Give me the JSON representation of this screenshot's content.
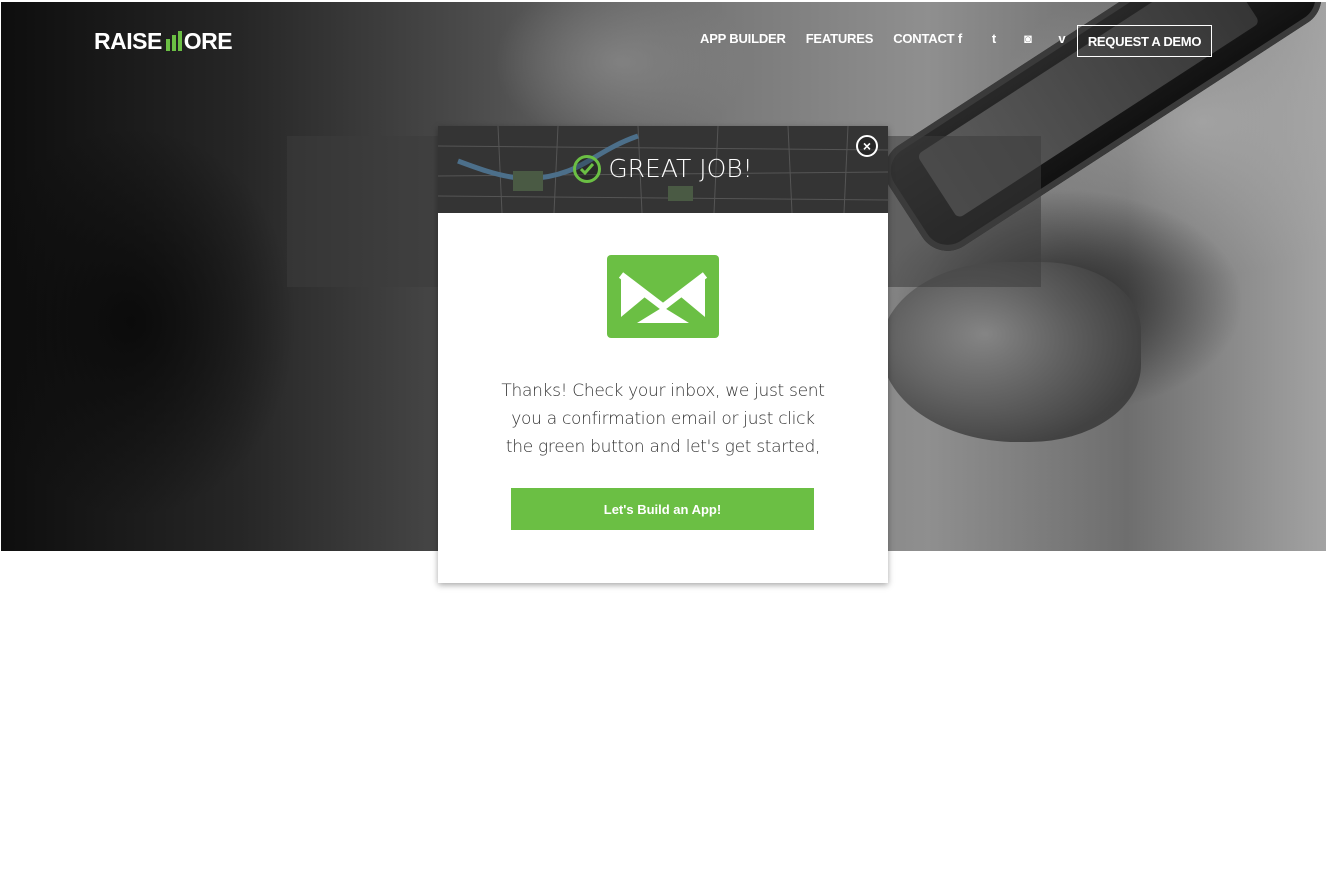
{
  "header": {
    "logo_text_left": "RAISE",
    "logo_text_right": "ORE",
    "nav": [
      "APP BUILDER",
      "FEATURES",
      "CONTACT"
    ],
    "social_icons": [
      "facebook-icon",
      "twitter-icon",
      "instagram-icon",
      "vimeo-icon"
    ],
    "social_glyphs": [
      "f",
      "t",
      "◙",
      "v"
    ],
    "demo_button": "REQUEST A DEMO"
  },
  "modal": {
    "title": "GREAT JOB!",
    "close_glyph": "×",
    "message": "Thanks! Check your inbox, we just sent you a confirmation email or just click the green button and let's get started,",
    "button": "Let's Build an App!"
  },
  "colors": {
    "accent_green": "#6bbf44",
    "modal_bg": "#ffffff",
    "header_text": "#ffffff"
  }
}
